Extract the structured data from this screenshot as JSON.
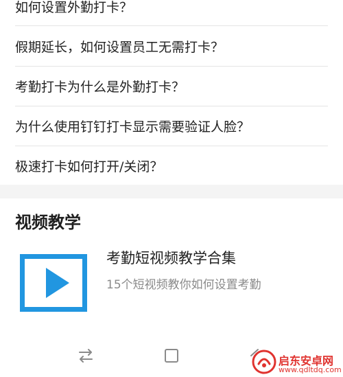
{
  "faq": {
    "items": [
      {
        "label": "如何设置外勤打卡？"
      },
      {
        "label": "假期延长，如何设置员工无需打卡？"
      },
      {
        "label": "考勤打卡为什么是外勤打卡？"
      },
      {
        "label": "为什么使用钉钉打卡显示需要验证人脸？"
      },
      {
        "label": "极速打卡如何打开/关闭？"
      }
    ]
  },
  "video_section": {
    "title": "视频教学",
    "card": {
      "title": "考勤短视频教学合集",
      "subtitle": "15个短视频教你如何设置考勤"
    }
  },
  "navbar": {
    "icons": [
      "switch-arrows-icon",
      "square-home-icon",
      "back-arrow-icon"
    ]
  },
  "watermark": {
    "text": "启东安卓网",
    "url": "www.qdltdq.com"
  },
  "colors": {
    "accent": "#2196e0",
    "text": "#222222",
    "muted": "#8a8a8a",
    "divider": "#e4e4e4",
    "watermark": "#e0332f"
  }
}
